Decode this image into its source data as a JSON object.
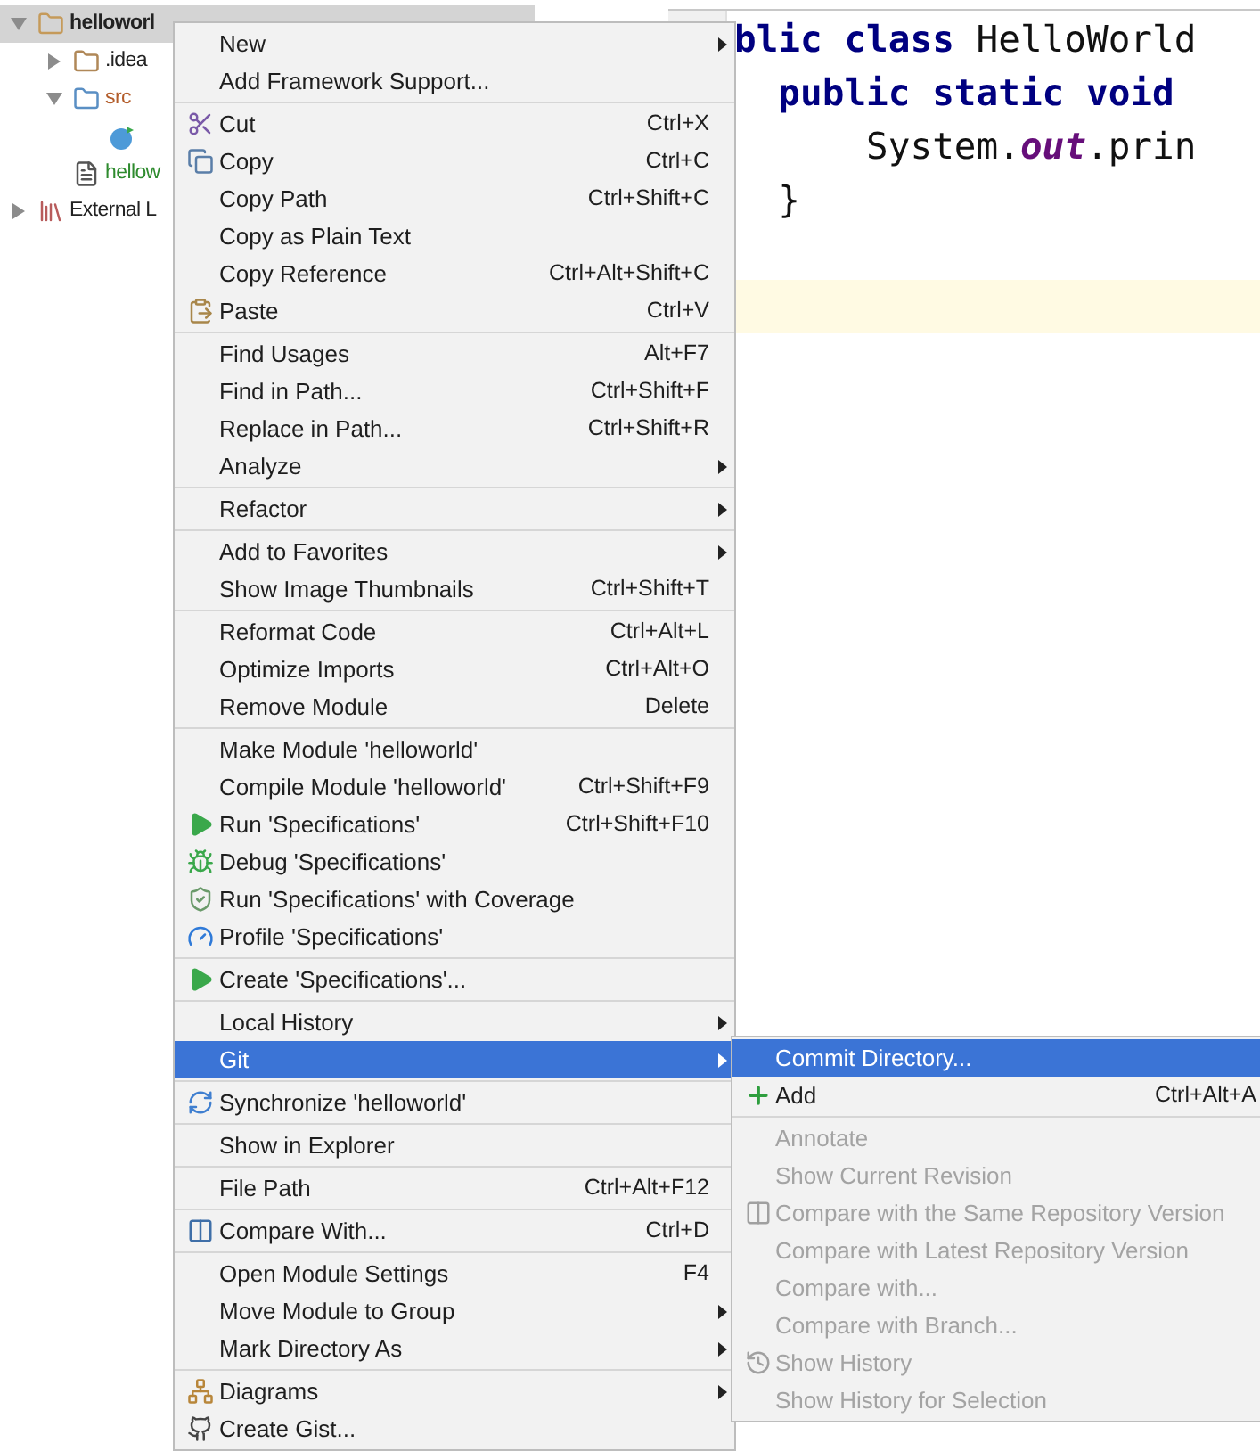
{
  "project_tree": [
    {
      "label": "helloworl",
      "expanded": true,
      "selected": true,
      "children": [
        {
          "label": ".idea",
          "expanded": false,
          "selected": false
        },
        {
          "label": "src",
          "expanded": true,
          "selected": false,
          "children": [
            {
              "selected": false
            }
          ]
        },
        {
          "label": "hellow",
          "selected": false
        }
      ]
    },
    {
      "label": "External L",
      "expanded": false,
      "selected": false
    }
  ],
  "editor": {
    "lines": [
      {
        "current": false,
        "tokens": [
          {
            "kind": "keyword",
            "text": "blic class "
          },
          {
            "kind": "plain",
            "text": "HelloWorld"
          }
        ]
      },
      {
        "current": false,
        "tokens": [
          {
            "kind": "keyword",
            "text": "  public static void"
          }
        ]
      },
      {
        "current": false,
        "tokens": [
          {
            "kind": "plain",
            "text": "      System."
          },
          {
            "kind": "field",
            "text": "out"
          },
          {
            "kind": "plain",
            "text": ".prin"
          }
        ]
      },
      {
        "current": false,
        "tokens": [
          {
            "kind": "plain",
            "text": "  }"
          }
        ]
      },
      {
        "current": false
      },
      {
        "current": true
      }
    ]
  },
  "context_menu": {
    "groups": [
      [
        {
          "label": "New",
          "submenu": true,
          "selected": false
        },
        {
          "label": "Add Framework Support...",
          "submenu": false,
          "selected": false
        }
      ],
      [
        {
          "label": "Cut",
          "shortcut": "Ctrl+X",
          "submenu": false,
          "selected": false
        },
        {
          "label": "Copy",
          "shortcut": "Ctrl+C",
          "submenu": false,
          "selected": false
        },
        {
          "label": "Copy Path",
          "shortcut": "Ctrl+Shift+C",
          "submenu": false,
          "selected": false
        },
        {
          "label": "Copy as Plain Text",
          "submenu": false,
          "selected": false
        },
        {
          "label": "Copy Reference",
          "shortcut": "Ctrl+Alt+Shift+C",
          "submenu": false,
          "selected": false
        },
        {
          "label": "Paste",
          "shortcut": "Ctrl+V",
          "submenu": false,
          "selected": false
        }
      ],
      [
        {
          "label": "Find Usages",
          "shortcut": "Alt+F7",
          "submenu": false,
          "selected": false
        },
        {
          "label": "Find in Path...",
          "shortcut": "Ctrl+Shift+F",
          "submenu": false,
          "selected": false
        },
        {
          "label": "Replace in Path...",
          "shortcut": "Ctrl+Shift+R",
          "submenu": false,
          "selected": false
        },
        {
          "label": "Analyze",
          "submenu": true,
          "selected": false
        }
      ],
      [
        {
          "label": "Refactor",
          "submenu": true,
          "selected": false
        }
      ],
      [
        {
          "label": "Add to Favorites",
          "submenu": true,
          "selected": false
        },
        {
          "label": "Show Image Thumbnails",
          "shortcut": "Ctrl+Shift+T",
          "submenu": false,
          "selected": false
        }
      ],
      [
        {
          "label": "Reformat Code",
          "shortcut": "Ctrl+Alt+L",
          "submenu": false,
          "selected": false
        },
        {
          "label": "Optimize Imports",
          "shortcut": "Ctrl+Alt+O",
          "submenu": false,
          "selected": false
        },
        {
          "label": "Remove Module",
          "shortcut": "Delete",
          "submenu": false,
          "selected": false
        }
      ],
      [
        {
          "label": "Make Module 'helloworld'",
          "submenu": false,
          "selected": false
        },
        {
          "label": "Compile Module 'helloworld'",
          "shortcut": "Ctrl+Shift+F9",
          "submenu": false,
          "selected": false
        },
        {
          "label": "Run 'Specifications'",
          "shortcut": "Ctrl+Shift+F10",
          "submenu": false,
          "selected": false
        },
        {
          "label": "Debug 'Specifications'",
          "submenu": false,
          "selected": false
        },
        {
          "label": "Run 'Specifications' with Coverage",
          "submenu": false,
          "selected": false
        },
        {
          "label": "Profile 'Specifications'",
          "submenu": false,
          "selected": false
        }
      ],
      [
        {
          "label": "Create 'Specifications'...",
          "submenu": false,
          "selected": false
        }
      ],
      [
        {
          "label": "Local History",
          "submenu": true,
          "selected": false
        },
        {
          "label": "Git",
          "submenu": true,
          "selected": true
        }
      ],
      [
        {
          "label": "Synchronize 'helloworld'",
          "submenu": false,
          "selected": false
        }
      ],
      [
        {
          "label": "Show in Explorer",
          "submenu": false,
          "selected": false
        }
      ],
      [
        {
          "label": "File Path",
          "shortcut": "Ctrl+Alt+F12",
          "submenu": false,
          "selected": false
        }
      ],
      [
        {
          "label": "Compare With...",
          "shortcut": "Ctrl+D",
          "submenu": false,
          "selected": false
        }
      ],
      [
        {
          "label": "Open Module Settings",
          "shortcut": "F4",
          "submenu": false,
          "selected": false
        },
        {
          "label": "Move Module to Group",
          "submenu": true,
          "selected": false
        },
        {
          "label": "Mark Directory As",
          "submenu": true,
          "selected": false
        }
      ],
      [
        {
          "label": "Diagrams",
          "submenu": true,
          "selected": false
        },
        {
          "label": "Create Gist...",
          "submenu": false,
          "selected": false
        }
      ]
    ]
  },
  "git_submenu": {
    "groups": [
      [
        {
          "label": "Commit Directory...",
          "selected": true,
          "disabled": false
        },
        {
          "label": "Add",
          "shortcut": "Ctrl+Alt+A",
          "selected": false,
          "disabled": false
        }
      ],
      [
        {
          "label": "Annotate",
          "selected": false,
          "disabled": true
        },
        {
          "label": "Show Current Revision",
          "selected": false,
          "disabled": true
        },
        {
          "label": "Compare with the Same Repository Version",
          "selected": false,
          "disabled": true
        },
        {
          "label": "Compare with Latest Repository Version",
          "selected": false,
          "disabled": true
        },
        {
          "label": "Compare with...",
          "selected": false,
          "disabled": true
        },
        {
          "label": "Compare with Branch...",
          "selected": false,
          "disabled": true
        },
        {
          "label": "Show History",
          "selected": false,
          "disabled": true
        },
        {
          "label": "Show History for Selection",
          "selected": false,
          "disabled": true
        }
      ]
    ]
  }
}
